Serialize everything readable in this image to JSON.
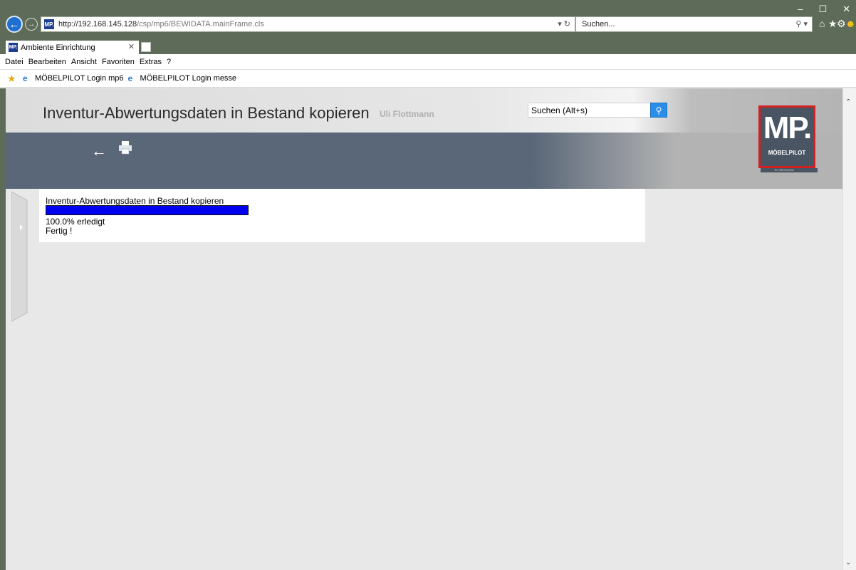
{
  "browser": {
    "url_host": "http://192.168.145.128",
    "url_path": "/csp/mp6/BEWIDATA.mainFrame.cls",
    "search_placeholder": "Suchen...",
    "tab_label": "Ambiente Einrichtung",
    "favicon_text": "MP.",
    "menu": [
      "Datei",
      "Bearbeiten",
      "Ansicht",
      "Favoriten",
      "Extras",
      "?"
    ],
    "favorites": [
      "MÖBELPILOT Login mp6",
      "MÖBELPILOT Login messe"
    ]
  },
  "app": {
    "title": "Inventur-Abwertungsdaten in Bestand kopieren",
    "user": "Uli Flottmann",
    "search_value": "Suchen (Alt+s)",
    "logo_text": "MP.",
    "logo_name": "MÖBELPILOT",
    "logo_by": "BY BEWIDATA"
  },
  "job": {
    "title": "Inventur-Abwertungsdaten in Bestand kopieren",
    "progress_percent": 100,
    "progress_text": "100.0% erledigt",
    "status": "Fertig !"
  },
  "colors": {
    "chrome": "#5d6b58",
    "progress_fill": "#0000f0",
    "logo_border": "#d32020",
    "logo_bg": "#4a5563"
  }
}
